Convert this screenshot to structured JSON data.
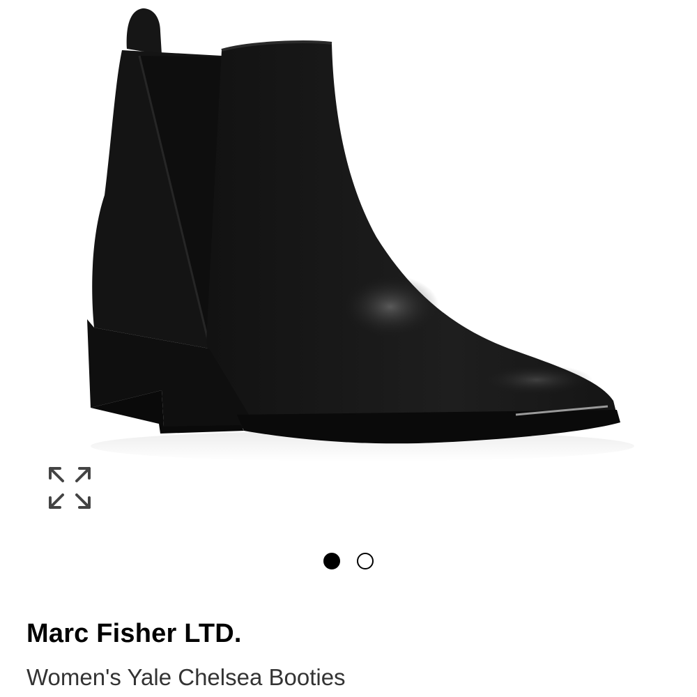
{
  "product": {
    "brand": "Marc Fisher LTD.",
    "name": "Women's Yale Chelsea Booties",
    "image_description_icon": "chelsea-boot-image"
  },
  "gallery": {
    "total_images": 2,
    "active_index": 0,
    "expand_icon": "expand-arrows-icon"
  },
  "colors": {
    "background": "#ffffff",
    "boot": "#1a1a1a",
    "dot_active": "#000000"
  }
}
